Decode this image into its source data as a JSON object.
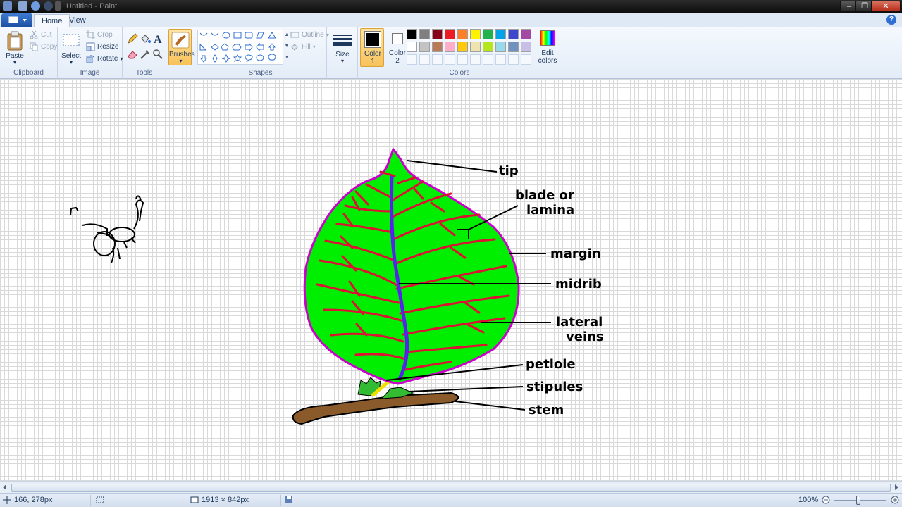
{
  "window": {
    "title": "Untitled - Paint",
    "minimize": "‒",
    "maximize": "❐",
    "close": "✕"
  },
  "tabs": {
    "home": "Home",
    "view": "View"
  },
  "help": "?",
  "ribbon": {
    "clipboard": {
      "label": "Clipboard",
      "paste": "Paste",
      "cut": "Cut",
      "copy": "Copy"
    },
    "image": {
      "label": "Image",
      "select": "Select",
      "crop": "Crop",
      "resize": "Resize",
      "rotate": "Rotate"
    },
    "tools": {
      "label": "Tools"
    },
    "brushes": {
      "label": "Brushes"
    },
    "shapes": {
      "label": "Shapes",
      "outline": "Outline",
      "fill": "Fill"
    },
    "size": {
      "label": "Size"
    },
    "colors": {
      "label": "Colors",
      "color1_label": "Color",
      "color1_num": "1",
      "color2_label": "Color",
      "color2_num": "2",
      "edit_colors_line1": "Edit",
      "edit_colors_line2": "colors",
      "color1": "#000000",
      "color2": "#ffffff",
      "palette_row1": [
        "#000000",
        "#7f7f7f",
        "#880015",
        "#ed1c24",
        "#ff7f27",
        "#fff200",
        "#22b14c",
        "#00a2e8",
        "#3f48cc",
        "#a349a4"
      ],
      "palette_row2": [
        "#ffffff",
        "#c3c3c3",
        "#b97a57",
        "#ffaec9",
        "#ffc90e",
        "#efe4b0",
        "#b5e61d",
        "#99d9ea",
        "#7092be",
        "#c8bfe7"
      ]
    }
  },
  "diagram": {
    "labels": {
      "tip": "tip",
      "blade_line1": "blade or",
      "blade_line2": "lamina",
      "margin": "margin",
      "midrib": "midrib",
      "lateral_line1": "lateral",
      "lateral_line2": "veins",
      "petiole": "petiole",
      "stipules": "stipules",
      "stem": "stem"
    },
    "colors": {
      "leaf": "#00ee00",
      "margin": "#cc00cc",
      "veins": "#dd1133",
      "midrib": "#5522ee",
      "stem": "#8b5a2b"
    }
  },
  "status": {
    "cursor_pos": "166, 278px",
    "canvas_size": "1913 × 842px",
    "zoom": "100%"
  }
}
